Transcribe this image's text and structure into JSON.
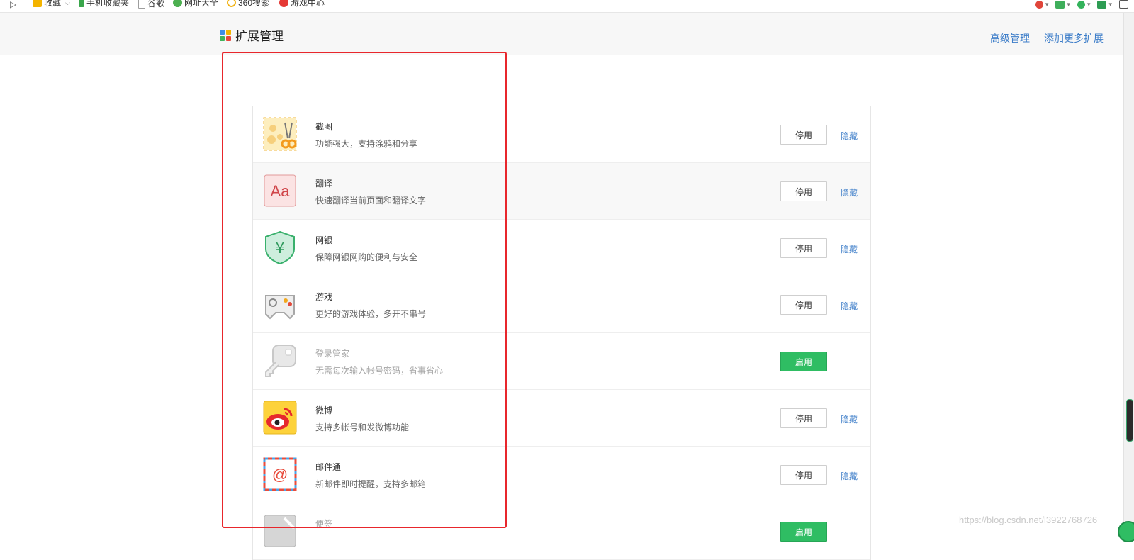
{
  "bookmarks": {
    "collapse_glyph": "▷",
    "items": [
      {
        "label": "收藏",
        "icon": "star-icon",
        "color": "#f4b400",
        "has_dropdown": true
      },
      {
        "label": "手机收藏夹",
        "icon": "phone-icon",
        "color": "#3aa64b"
      },
      {
        "label": "谷歌",
        "icon": "page-icon",
        "color": "#9e9e9e"
      },
      {
        "label": "网址大全",
        "icon": "site-icon",
        "color": "#4caf50"
      },
      {
        "label": "360搜索",
        "icon": "search-360-icon",
        "color": "#f1b51c"
      },
      {
        "label": "游戏中心",
        "icon": "game-center-icon",
        "color": "#e53935"
      }
    ]
  },
  "toolbar_icons": [
    "scissors-icon",
    "translate-icon",
    "bank-shield-icon",
    "game-icon",
    "apps-grid-icon"
  ],
  "header": {
    "title": "扩展管理",
    "links": [
      "高级管理",
      "添加更多扩展"
    ]
  },
  "extensions": [
    {
      "icon": "screenshot-scissors-icon",
      "name": "截图",
      "desc": "功能强大，支持涂鸦和分享",
      "enabled": true,
      "action": "停用",
      "hide": "隐藏"
    },
    {
      "icon": "translate-aa-icon",
      "name": "翻译",
      "desc": "快速翻译当前页面和翻译文字",
      "enabled": true,
      "action": "停用",
      "hide": "隐藏"
    },
    {
      "icon": "yuan-shield-icon",
      "name": "网银",
      "desc": "保障网银网购的便利与安全",
      "enabled": true,
      "action": "停用",
      "hide": "隐藏"
    },
    {
      "icon": "gamepad-icon",
      "name": "游戏",
      "desc": "更好的游戏体验，多开不串号",
      "enabled": true,
      "action": "停用",
      "hide": "隐藏"
    },
    {
      "icon": "key-icon",
      "name": "登录管家",
      "desc": "无需每次输入帐号密码，省事省心",
      "enabled": false,
      "action": "启用",
      "hide": ""
    },
    {
      "icon": "weibo-icon",
      "name": "微博",
      "desc": "支持多帐号和发微博功能",
      "enabled": true,
      "action": "停用",
      "hide": "隐藏"
    },
    {
      "icon": "mail-at-icon",
      "name": "邮件通",
      "desc": "新邮件即时提醒，支持多邮箱",
      "enabled": true,
      "action": "停用",
      "hide": "隐藏"
    },
    {
      "icon": "notes-icon",
      "name": "便签",
      "desc": "",
      "enabled": false,
      "action": "启用",
      "hide": ""
    }
  ],
  "colors": {
    "link": "#3e7ec9",
    "enable_button": "#2fbd63",
    "annotation_box": "#e8262c"
  },
  "watermark": "https://blog.csdn.net/l3922768726"
}
